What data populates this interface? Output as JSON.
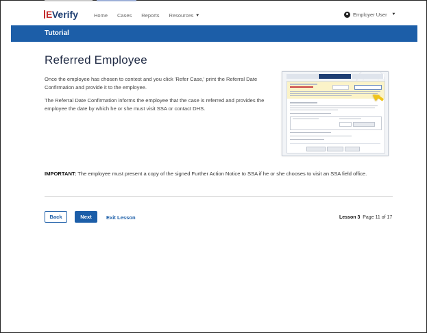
{
  "brand": {
    "name_prefix": "E",
    "name_suffix": "Verify"
  },
  "nav": {
    "links": [
      "Home",
      "Cases",
      "Reports",
      "Resources"
    ],
    "user_label": "Employer User"
  },
  "banner": {
    "title": "Tutorial"
  },
  "content": {
    "title": "Referred Employee",
    "paragraph_1": "Once the employee has chosen to contest and you click 'Refer Case,' print the Referral Date Confirmation and provide it to the employee.",
    "paragraph_2": "The Referral Date Confirmation informs the employee that the case is referred and provides the employee the date by which he or she must visit SSA or contact DHS.",
    "important_label": "IMPORTANT:",
    "important_text": " The employee must present a copy of the signed Further Action Notice to SSA if he or she chooses to visit an SSA field office."
  },
  "footer": {
    "back_label": "Back",
    "next_label": "Next",
    "exit_label": "Exit Lesson",
    "lesson_label": "Lesson 3",
    "page_label": "Page 11 of 17"
  },
  "colors": {
    "brand_blue": "#1c5ea8",
    "brand_red": "#c22a2a",
    "highlight_yellow": "#fbf3c8"
  }
}
